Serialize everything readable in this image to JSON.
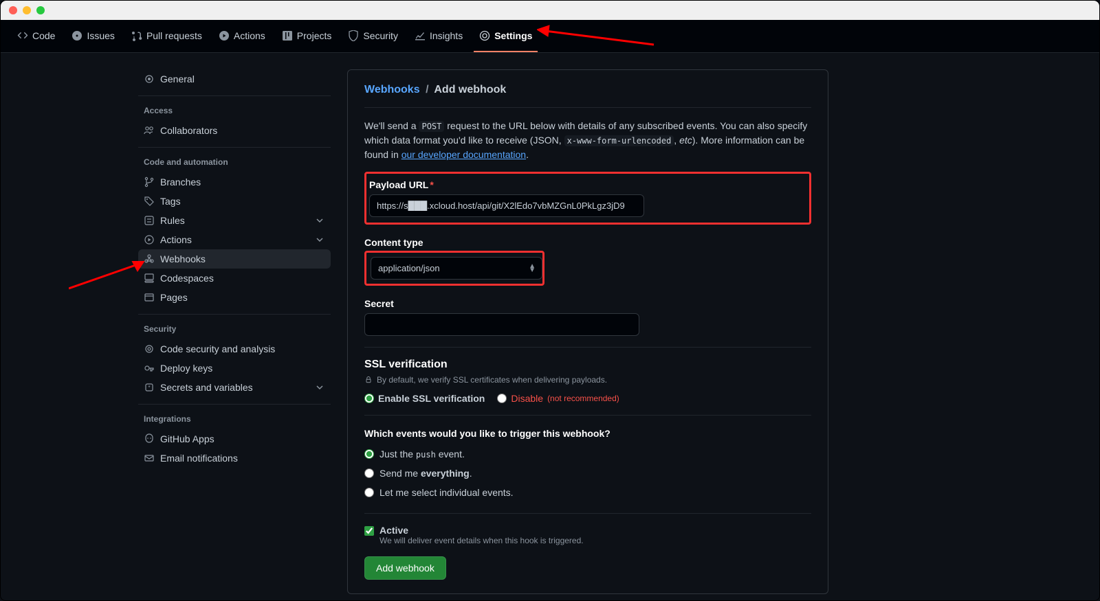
{
  "nav": {
    "code": "Code",
    "issues": "Issues",
    "pulls": "Pull requests",
    "actions": "Actions",
    "projects": "Projects",
    "security": "Security",
    "insights": "Insights",
    "settings": "Settings"
  },
  "sidebar": {
    "general": "General",
    "access_heading": "Access",
    "collaborators": "Collaborators",
    "code_heading": "Code and automation",
    "branches": "Branches",
    "tags": "Tags",
    "rules": "Rules",
    "actions": "Actions",
    "webhooks": "Webhooks",
    "codespaces": "Codespaces",
    "pages": "Pages",
    "security_heading": "Security",
    "code_security": "Code security and analysis",
    "deploy_keys": "Deploy keys",
    "secrets": "Secrets and variables",
    "integrations_heading": "Integrations",
    "github_apps": "GitHub Apps",
    "email_notifications": "Email notifications"
  },
  "breadcrumb": {
    "webhooks": "Webhooks",
    "add": "Add webhook"
  },
  "intro": {
    "p1_a": "We'll send a ",
    "p1_code1": "POST",
    "p1_b": " request to the URL below with details of any subscribed events. You can also specify which data format you'd like to receive (JSON, ",
    "p1_code2": "x-www-form-urlencoded",
    "p1_c": ", ",
    "p1_em": "etc",
    "p1_d": "). More information can be found in ",
    "p1_link": "our developer documentation",
    "p1_e": "."
  },
  "form": {
    "payload_label": "Payload URL",
    "payload_value": "https://s███.xcloud.host/api/git/X2lEdo7vbMZGnL0PkLgz3jD9",
    "content_type_label": "Content type",
    "content_type_value": "application/json",
    "secret_label": "Secret",
    "secret_value": "",
    "ssl_heading": "SSL verification",
    "ssl_note": "By default, we verify SSL certificates when delivering payloads.",
    "ssl_enable": "Enable SSL verification",
    "ssl_disable": "Disable",
    "ssl_disable_note": "(not recommended)",
    "events_heading": "Which events would you like to trigger this webhook?",
    "event_push_a": "Just the ",
    "event_push_code": "push",
    "event_push_b": " event.",
    "event_everything_a": "Send me ",
    "event_everything_b": "everything",
    "event_everything_c": ".",
    "event_individual": "Let me select individual events.",
    "active_label": "Active",
    "active_desc": "We will deliver event details when this hook is triggered.",
    "submit": "Add webhook"
  }
}
